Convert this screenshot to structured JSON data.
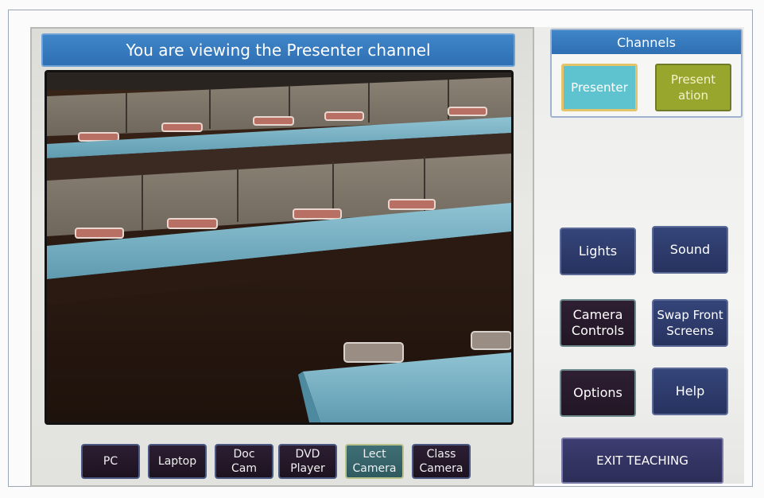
{
  "header": {
    "title": "You are viewing the Presenter channel"
  },
  "video": {
    "alt": "Presenter camera feed"
  },
  "sources": [
    {
      "label": "PC",
      "active": false
    },
    {
      "label": "Laptop",
      "active": false
    },
    {
      "label": "Doc Cam",
      "active": false
    },
    {
      "label": "DVD Player",
      "active": false
    },
    {
      "label": "Lect Camera",
      "active": true
    },
    {
      "label": "Class Camera",
      "active": false
    }
  ],
  "channels": {
    "title": "Channels",
    "presenter": "Presenter",
    "presentation": "Present ation"
  },
  "controls": {
    "lights": "Lights",
    "sound": "Sound",
    "camera_controls": "Camera Controls",
    "swap_front_screens": "Swap Front Screens",
    "options": "Options",
    "help": "Help",
    "exit": "EXIT TEACHING"
  },
  "colors": {
    "title_bar": "#2f6fb3",
    "presenter_active": "#5fc3cf",
    "presentation": "#98a62e",
    "control_button": "#27325e",
    "source_button": "#1d1320"
  }
}
